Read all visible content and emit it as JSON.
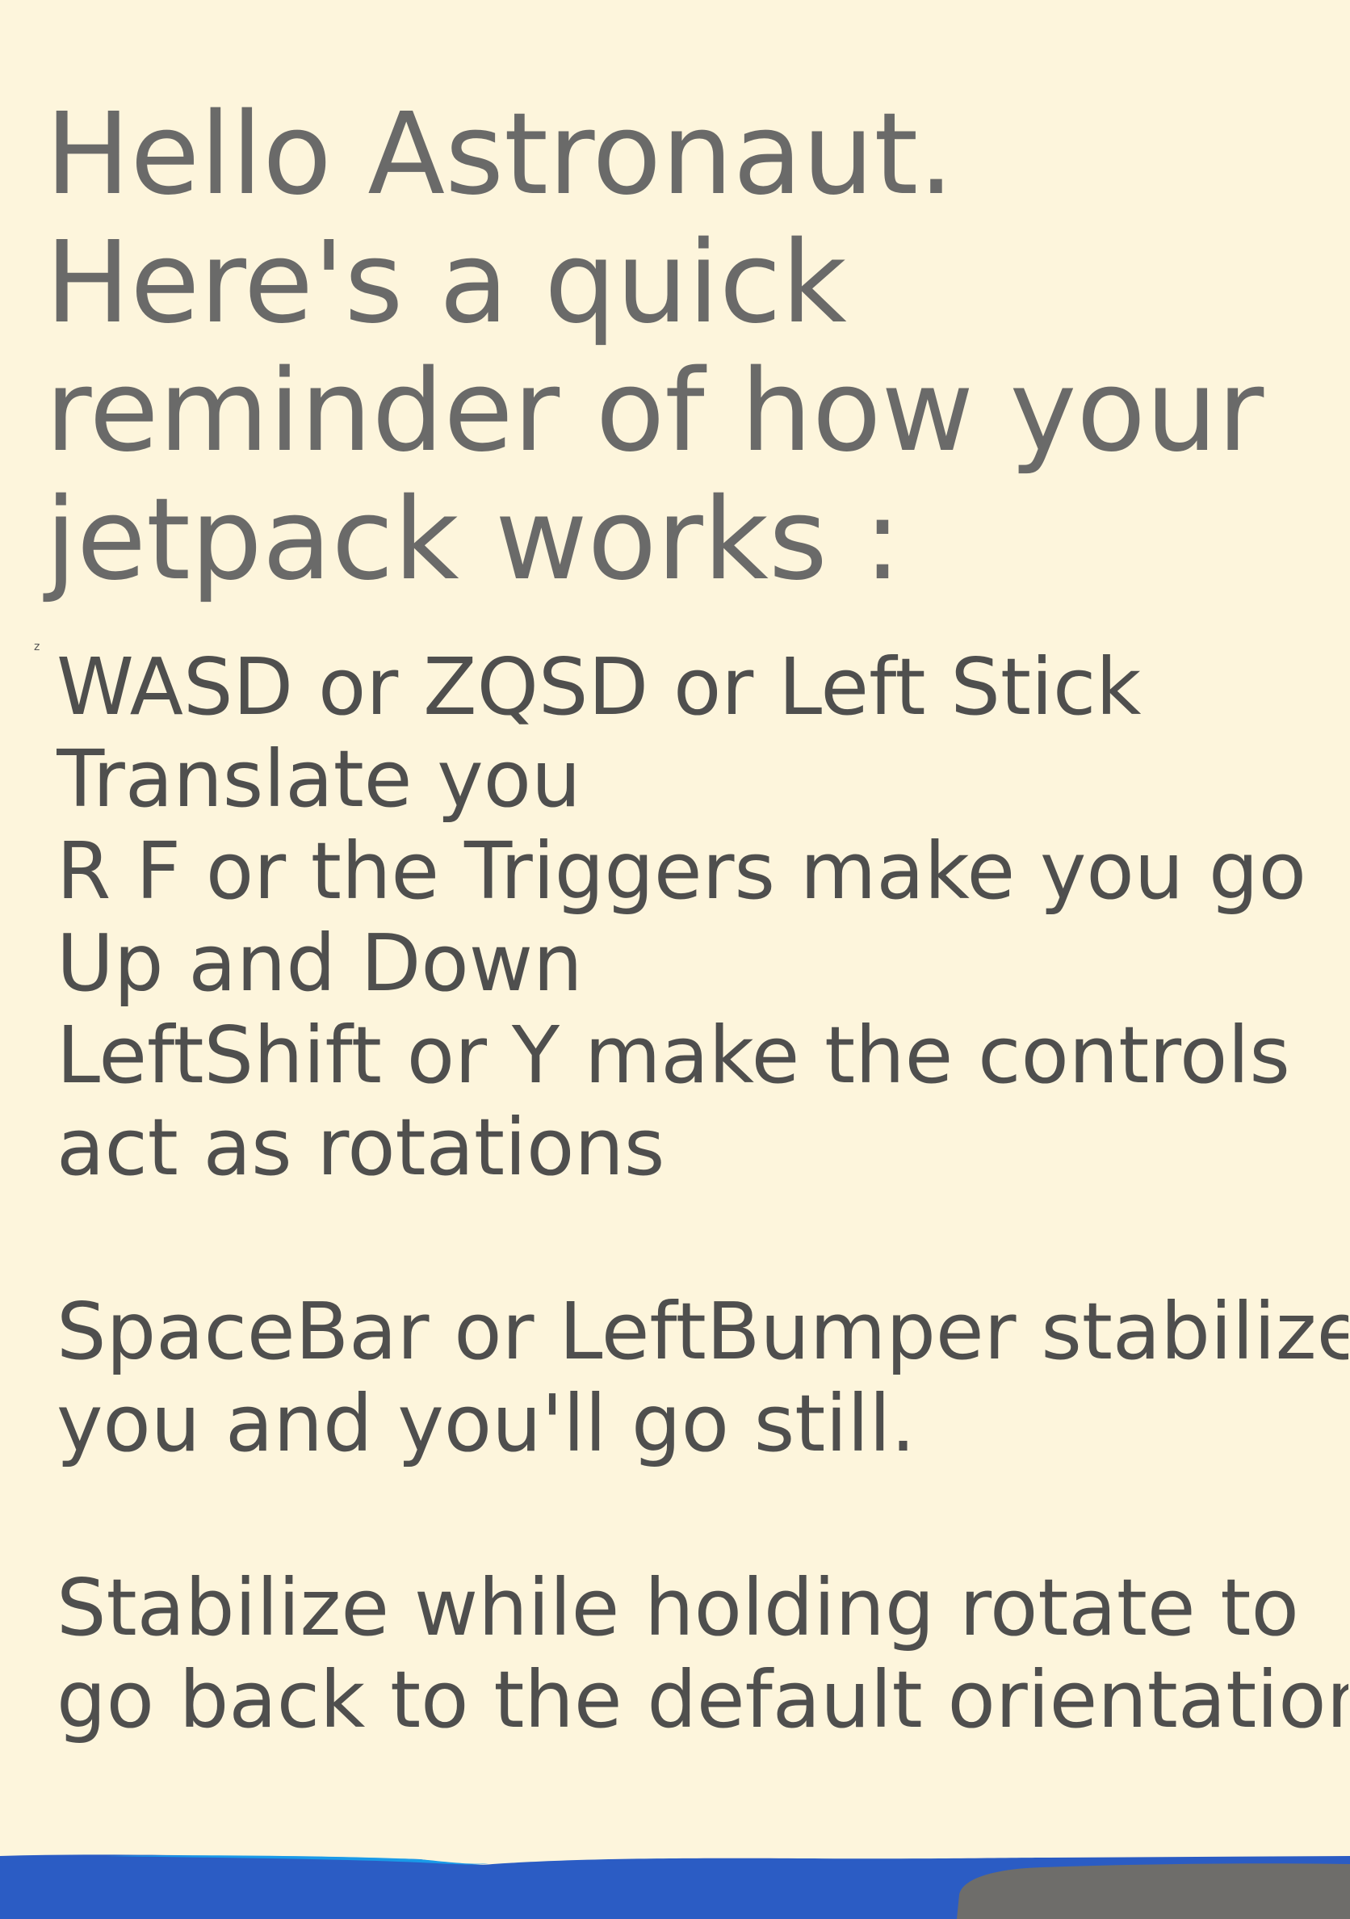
{
  "heading": {
    "lines": [
      "Hello Astronaut.",
      "Here's a quick",
      "reminder of how your",
      "jetpack works :"
    ]
  },
  "stray_mark": "z",
  "instructions": {
    "translate": [
      "WASD or ZQSD or Left Stick",
      "Translate you"
    ],
    "vertical": [
      "R F or the Triggers make you go",
      "Up and Down"
    ],
    "rotate_mode": [
      "LeftShift or Y make the controls",
      "act as rotations"
    ],
    "stabilize": [
      "SpaceBar or LeftBumper stabilize",
      "you and you'll go still."
    ],
    "reset_orientation": [
      "Stabilize while holding rotate to",
      "go back to the default orientation"
    ]
  },
  "colors": {
    "background": "#fdf5dc",
    "heading_text": "#6a6a69",
    "body_text": "#4f4f4e",
    "ground_blue": "#2b5cc4",
    "ground_light_blue": "#1a9ae8",
    "rock_gray": "#6e6d6a"
  }
}
